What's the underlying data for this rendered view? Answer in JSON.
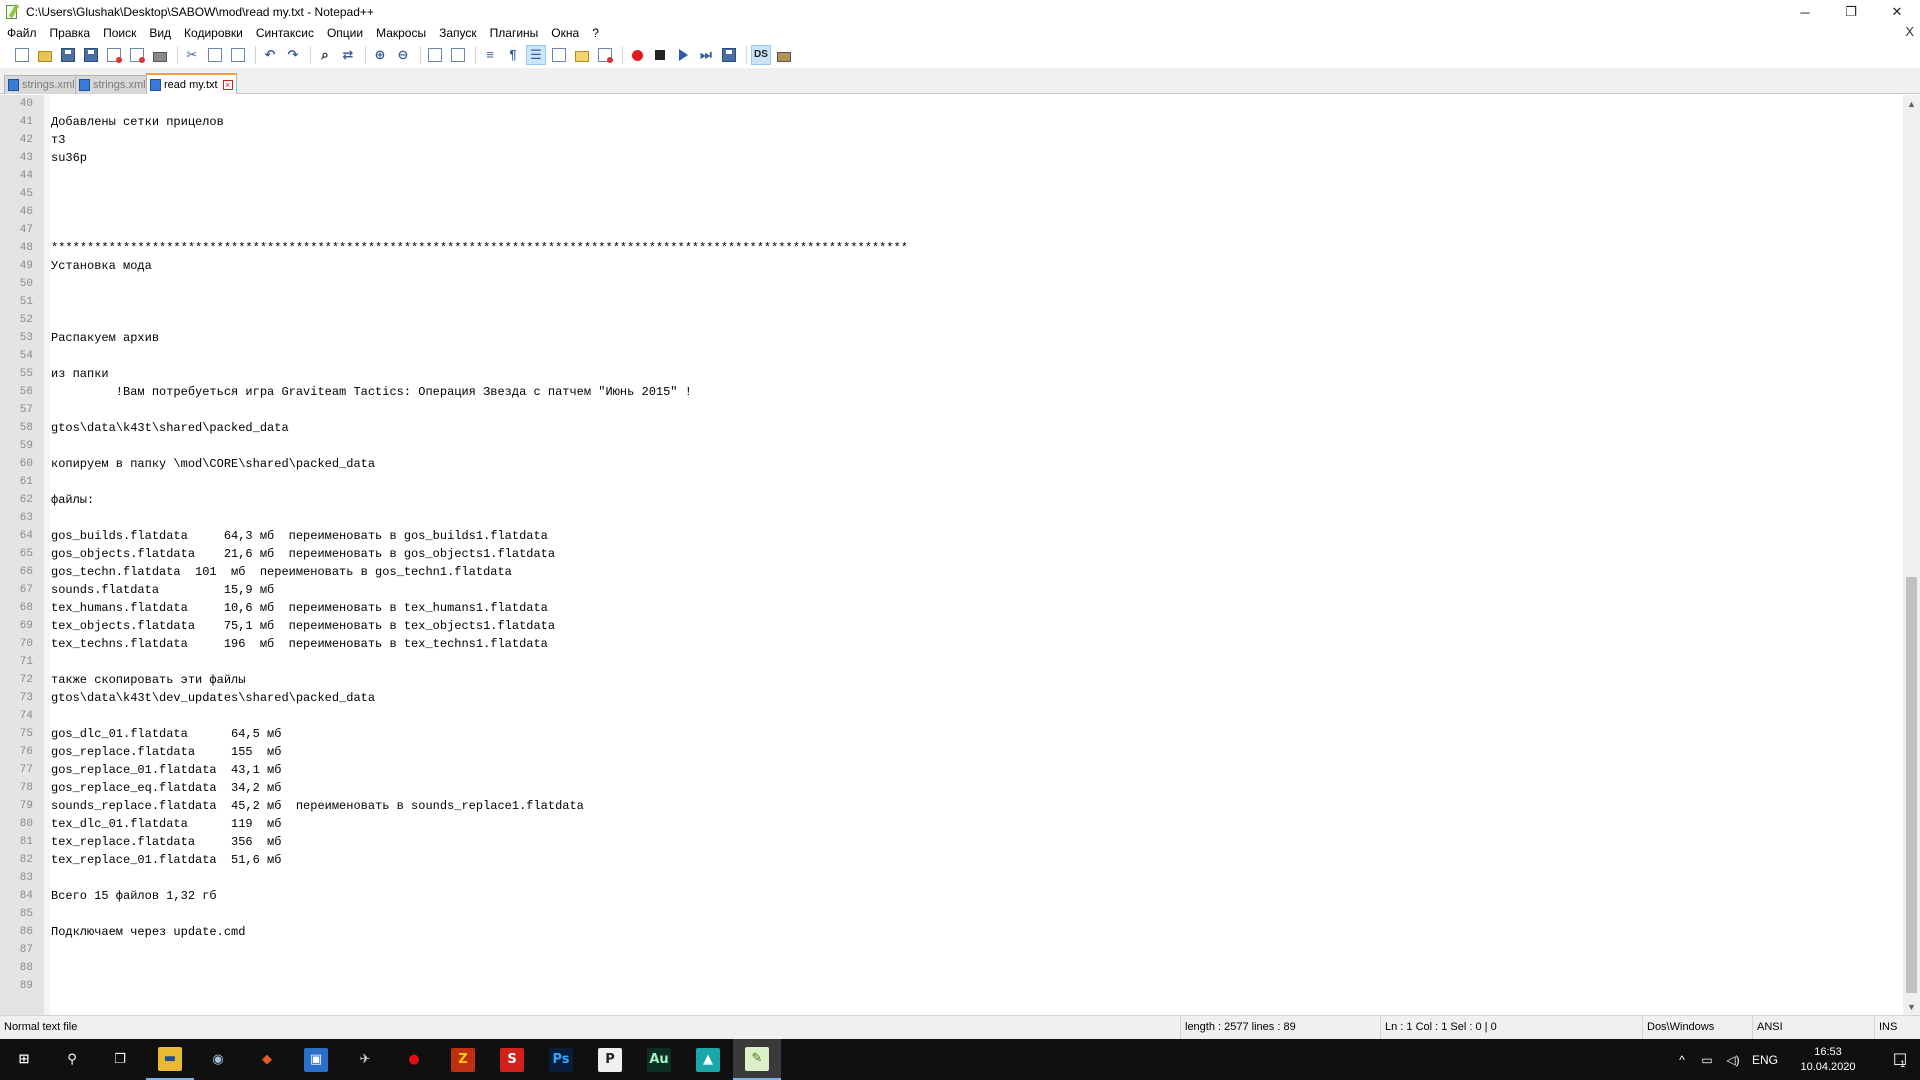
{
  "window": {
    "title": "C:\\Users\\Glushak\\Desktop\\SABOW\\mod\\read my.txt - Notepad++",
    "controls": {
      "minimize": "─",
      "maximize": "❐",
      "close": "✕"
    }
  },
  "menu": {
    "items": [
      "Файл",
      "Правка",
      "Поиск",
      "Вид",
      "Кодировки",
      "Синтаксис",
      "Опции",
      "Макросы",
      "Запуск",
      "Плагины",
      "Окна",
      "?"
    ],
    "close_doc": "X"
  },
  "toolbar": {
    "buttons": [
      "new-file-icon",
      "open-file-icon",
      "save-icon",
      "save-all-icon",
      "close-icon",
      "close-all-icon",
      "print-icon",
      "cut-icon",
      "copy-icon",
      "paste-icon",
      "undo-icon",
      "redo-icon",
      "find-icon",
      "replace-icon",
      "zoom-in-icon",
      "zoom-out-icon",
      "sync-vertical-icon",
      "sync-horizontal-icon",
      "word-wrap-icon",
      "show-all-chars-icon",
      "indent-guide-icon",
      "document-map-icon",
      "function-list-icon",
      "folder-workspace-icon",
      "record-macro-icon",
      "stop-record-icon",
      "play-macro-icon",
      "run-macro-multiple-icon",
      "save-macro-icon",
      "ds-icon",
      "plugin-icon"
    ]
  },
  "tabs": [
    {
      "label": "strings.xml",
      "active": false
    },
    {
      "label": "strings.xml",
      "active": false
    },
    {
      "label": "read my.txt",
      "active": true
    }
  ],
  "editor": {
    "lines": [
      {
        "n": "40",
        "t": ""
      },
      {
        "n": "41",
        "t": "Добавлены сетки прицелов"
      },
      {
        "n": "42",
        "t": "т3"
      },
      {
        "n": "43",
        "t": "su36p"
      },
      {
        "n": "44",
        "t": ""
      },
      {
        "n": "45",
        "t": ""
      },
      {
        "n": "46",
        "t": ""
      },
      {
        "n": "47",
        "t": ""
      },
      {
        "n": "48",
        "t": "***********************************************************************************************************************"
      },
      {
        "n": "49",
        "t": "Установка мода"
      },
      {
        "n": "50",
        "t": ""
      },
      {
        "n": "51",
        "t": ""
      },
      {
        "n": "52",
        "t": ""
      },
      {
        "n": "53",
        "t": "Распакуем архив"
      },
      {
        "n": "54",
        "t": ""
      },
      {
        "n": "55",
        "t": "из папки"
      },
      {
        "n": "56",
        "t": "         !Вам потребуеться игра Graviteam Tactics: Операция Звезда с патчем \"Июнь 2015\" !"
      },
      {
        "n": "57",
        "t": ""
      },
      {
        "n": "58",
        "t": "gtos\\data\\k43t\\shared\\packed_data"
      },
      {
        "n": "59",
        "t": ""
      },
      {
        "n": "60",
        "t": "копируем в папку \\mod\\CORE\\shared\\packed_data"
      },
      {
        "n": "61",
        "t": ""
      },
      {
        "n": "62",
        "t": "файлы:"
      },
      {
        "n": "63",
        "t": ""
      },
      {
        "n": "64",
        "t": "gos_builds.flatdata     64,3 мб  переименовать в gos_builds1.flatdata"
      },
      {
        "n": "65",
        "t": "gos_objects.flatdata    21,6 мб  переименовать в gos_objects1.flatdata"
      },
      {
        "n": "66",
        "t": "gos_techn.flatdata  101  мб  переименовать в gos_techn1.flatdata"
      },
      {
        "n": "67",
        "t": "sounds.flatdata         15,9 мб"
      },
      {
        "n": "68",
        "t": "tex_humans.flatdata     10,6 мб  переименовать в tex_humans1.flatdata"
      },
      {
        "n": "69",
        "t": "tex_objects.flatdata    75,1 мб  переименовать в tex_objects1.flatdata"
      },
      {
        "n": "70",
        "t": "tex_techns.flatdata     196  мб  переименовать в tex_techns1.flatdata"
      },
      {
        "n": "71",
        "t": ""
      },
      {
        "n": "72",
        "t": "также скопировать эти файлы"
      },
      {
        "n": "73",
        "t": "gtos\\data\\k43t\\dev_updates\\shared\\packed_data"
      },
      {
        "n": "74",
        "t": ""
      },
      {
        "n": "75",
        "t": "gos_dlc_01.flatdata      64,5 мб"
      },
      {
        "n": "76",
        "t": "gos_replace.flatdata     155  мб"
      },
      {
        "n": "77",
        "t": "gos_replace_01.flatdata  43,1 мб"
      },
      {
        "n": "78",
        "t": "gos_replace_eq.flatdata  34,2 мб"
      },
      {
        "n": "79",
        "t": "sounds_replace.flatdata  45,2 мб  переименовать в sounds_replace1.flatdata"
      },
      {
        "n": "80",
        "t": "tex_dlc_01.flatdata      119  мб"
      },
      {
        "n": "81",
        "t": "tex_replace.flatdata     356  мб"
      },
      {
        "n": "82",
        "t": "tex_replace_01.flatdata  51,6 мб"
      },
      {
        "n": "83",
        "t": ""
      },
      {
        "n": "84",
        "t": "Всего 15 файлов 1,32 гб"
      },
      {
        "n": "85",
        "t": ""
      },
      {
        "n": "86",
        "t": "Подключаем через update.cmd"
      },
      {
        "n": "87",
        "t": ""
      },
      {
        "n": "88",
        "t": ""
      },
      {
        "n": "89",
        "t": ""
      }
    ],
    "scroll_position_fraction": 0.45
  },
  "statusbar": {
    "file_type": "Normal text file",
    "length_lines": "length : 2577    lines : 89",
    "position": "Ln : 1    Col : 1    Sel : 0 | 0",
    "eol": "Dos\\Windows",
    "encoding": "ANSI",
    "mode": "INS"
  },
  "taskbar": {
    "apps": [
      {
        "name": "start-button",
        "glyph": "⊞",
        "bg": "transparent",
        "fg": "#ffffff"
      },
      {
        "name": "search-icon",
        "glyph": "⚲",
        "bg": "transparent",
        "fg": "#ffffff"
      },
      {
        "name": "task-view-icon",
        "glyph": "❐",
        "bg": "transparent",
        "fg": "#ffffff"
      },
      {
        "name": "file-explorer-icon",
        "glyph": "▬",
        "bg": "#e8b931",
        "fg": "#1e4f9c",
        "state": "open"
      },
      {
        "name": "app-icon-1",
        "glyph": "◉",
        "bg": "transparent",
        "fg": "#9ec5e8"
      },
      {
        "name": "app-icon-2",
        "glyph": "◆",
        "bg": "transparent",
        "fg": "#e05a2a"
      },
      {
        "name": "app-icon-3",
        "glyph": "▣",
        "bg": "#2a6fc9",
        "fg": "#ffffff"
      },
      {
        "name": "app-icon-4",
        "glyph": "✈",
        "bg": "transparent",
        "fg": "#d0d0d0"
      },
      {
        "name": "app-icon-5",
        "glyph": "●",
        "bg": "transparent",
        "fg": "#e01010"
      },
      {
        "name": "filezilla-icon",
        "glyph": "Z",
        "bg": "#bf2f10",
        "fg": "#ffcc00"
      },
      {
        "name": "app-icon-6",
        "glyph": "S",
        "bg": "#d2201a",
        "fg": "#ffffff"
      },
      {
        "name": "photoshop-icon",
        "glyph": "Ps",
        "bg": "#071d3a",
        "fg": "#31a8ff"
      },
      {
        "name": "app-icon-7",
        "glyph": "P",
        "bg": "#f0f0f0",
        "fg": "#222222"
      },
      {
        "name": "audition-icon",
        "glyph": "Au",
        "bg": "#0b2f22",
        "fg": "#9ff5c4"
      },
      {
        "name": "app-icon-8",
        "glyph": "▲",
        "bg": "#1aa7a7",
        "fg": "#ffffff"
      },
      {
        "name": "notepadpp-icon",
        "glyph": "✎",
        "bg": "#dcefc8",
        "fg": "#3c7a1e",
        "state": "active"
      }
    ],
    "tray": {
      "chevron": "^",
      "network": "▭",
      "volume": "◁)",
      "lang": "ENG",
      "time": "16:53",
      "date": "10.04.2020",
      "notifications": "☐",
      "notif_count": "1"
    }
  }
}
